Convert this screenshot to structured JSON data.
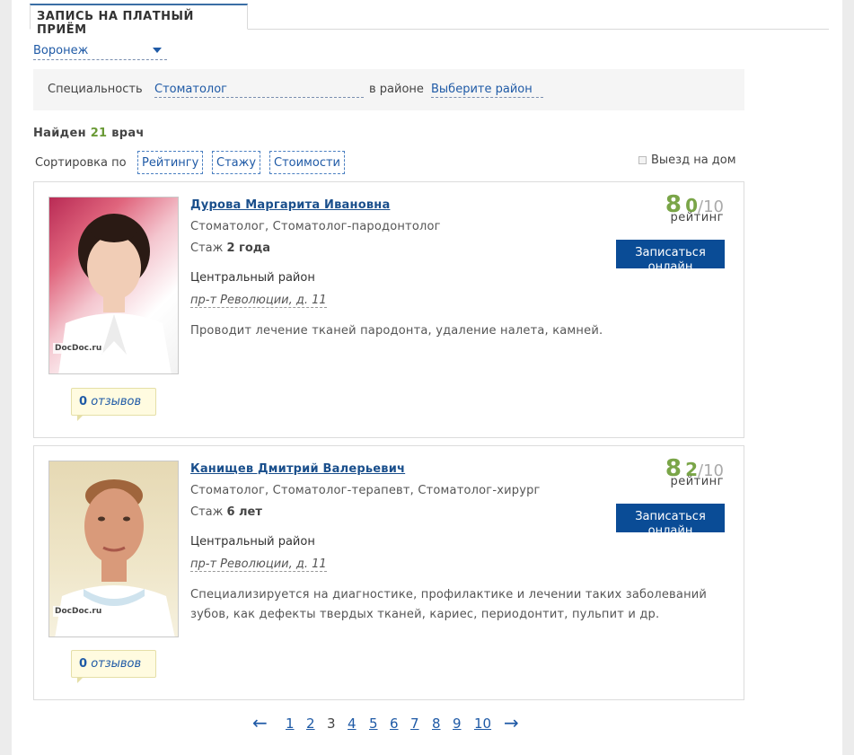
{
  "tab": {
    "title": "ЗАПИСЬ НА ПЛАТНЫЙ ПРИЁМ"
  },
  "city": {
    "value": "Воронеж"
  },
  "filter": {
    "speciality_label": "Специальность",
    "speciality_value": "Стоматолог",
    "district_label": "в районе",
    "district_value": "Выберите район"
  },
  "found": {
    "prefix": "Найден",
    "count": "21",
    "suffix": "врач"
  },
  "sort": {
    "label": "Сортировка по",
    "options": [
      "Рейтингу",
      "Стажу",
      "Стоимости"
    ],
    "home_visit_label": "Выезд на дом"
  },
  "doctors": [
    {
      "name": "Дурова Маргарита Ивановна",
      "specialities": "Стоматолог, Стоматолог-пародонтолог",
      "experience_label": "Стаж",
      "experience_value": "2 года",
      "district": "Центральный район",
      "address": "пр-т Революции, д. 11",
      "description": "Проводит лечение тканей пародонта, удаление налета, камней.",
      "rating_int": "8",
      "rating_dec": "0",
      "rating_max": "/10",
      "rating_label": "рейтинг",
      "book_label": "Записаться онлайн",
      "reviews_count": "0",
      "reviews_label": "отзывов",
      "watermark": "DocDoc.ru"
    },
    {
      "name": "Канищев Дмитрий Валерьевич",
      "specialities": "Стоматолог, Стоматолог-терапевт, Стоматолог-хирург",
      "experience_label": "Стаж",
      "experience_value": "6 лет",
      "district": "Центральный район",
      "address": "пр-т Революции, д. 11",
      "description": "Специализируется на диагностике, профилактике и лечении таких заболеваний зубов, как дефекты твердых тканей, кариес, периодонтит, пульпит и др.",
      "rating_int": "8",
      "rating_dec": "2",
      "rating_max": "/10",
      "rating_label": "рейтинг",
      "book_label": "Записаться онлайн",
      "reviews_count": "0",
      "reviews_label": "отзывов",
      "watermark": "DocDoc.ru"
    }
  ],
  "pagination": {
    "prev": "←",
    "pages": [
      "1",
      "2",
      "3",
      "4",
      "5",
      "6",
      "7",
      "8",
      "9",
      "10"
    ],
    "current": "3",
    "next": "→"
  }
}
